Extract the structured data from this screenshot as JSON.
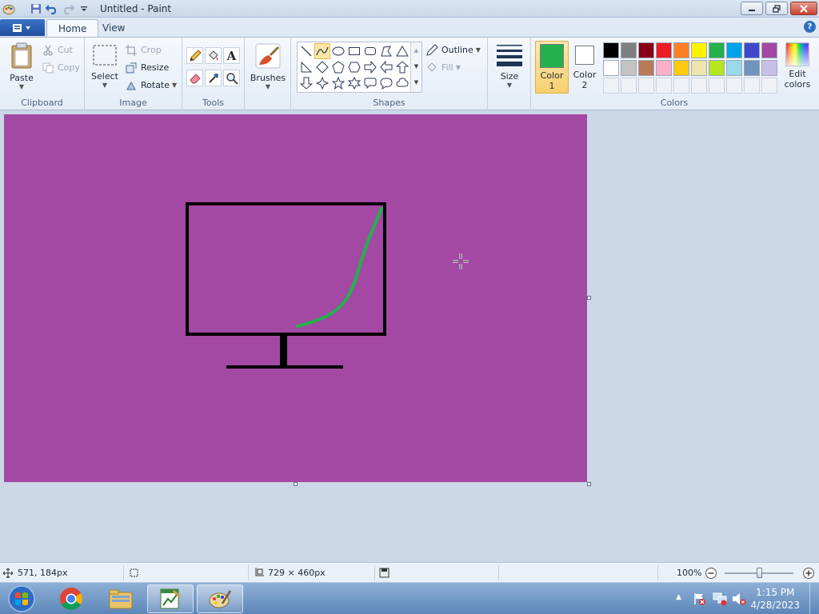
{
  "window": {
    "title": "Untitled - Paint"
  },
  "tabs": [
    {
      "label": "Home"
    },
    {
      "label": "View"
    }
  ],
  "clipboard": {
    "label": "Clipboard",
    "paste": "Paste",
    "cut": "Cut",
    "copy": "Copy"
  },
  "image": {
    "label": "Image",
    "select": "Select",
    "crop": "Crop",
    "resize": "Resize",
    "rotate": "Rotate"
  },
  "tools": {
    "label": "Tools"
  },
  "brushes": {
    "label": "Brushes"
  },
  "shapes": {
    "label": "Shapes",
    "outline": "Outline",
    "fill": "Fill"
  },
  "size": {
    "label": "Size"
  },
  "color1": {
    "label": "Color",
    "number": "1",
    "value": "#22b14c"
  },
  "color2": {
    "label": "Color",
    "number": "2",
    "value": "#ffffff"
  },
  "colors": {
    "label": "Colors",
    "edit": "Edit",
    "edit2": "colors",
    "row1": [
      "#000000",
      "#7f7f7f",
      "#880015",
      "#ed1c24",
      "#ff7f27",
      "#fff200",
      "#22b14c",
      "#00a2e8",
      "#3f48cc",
      "#a349a4"
    ],
    "row2": [
      "#ffffff",
      "#c3c3c3",
      "#b97a57",
      "#ffaec9",
      "#ffc90e",
      "#efe4b0",
      "#b5e61d",
      "#99d9ea",
      "#7092be",
      "#c8bfe7"
    ]
  },
  "canvas": {
    "background": "#a349a4"
  },
  "status": {
    "cursor_pos": "571, 184px",
    "canvas_size": "729 × 460px",
    "zoom": "100%"
  },
  "clock": {
    "time": "1:15 PM",
    "date": "4/28/2023"
  }
}
